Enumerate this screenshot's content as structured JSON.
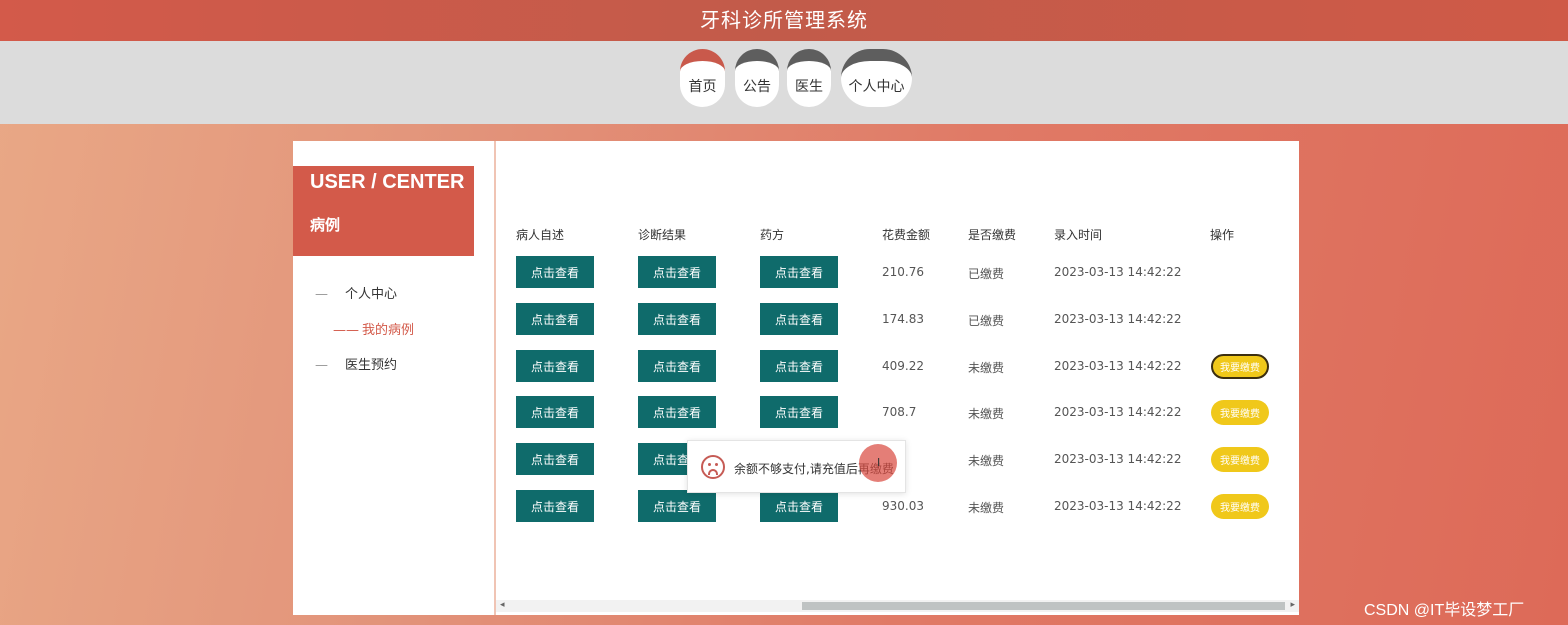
{
  "app_title": "牙科诊所管理系统",
  "nav": [
    "首页",
    "公告",
    "医生",
    "个人中心"
  ],
  "user_center": {
    "title": "USER / CENTER",
    "subtitle": "病例"
  },
  "side_menu": [
    {
      "label": "个人中心",
      "prefix": "—"
    },
    {
      "label": "我的病例",
      "prefix": "——"
    },
    {
      "label": "医生预约",
      "prefix": "—"
    }
  ],
  "table": {
    "headers": [
      "病人自述",
      "诊断结果",
      "药方",
      "花费金额",
      "是否缴费",
      "录入时间",
      "操作"
    ],
    "view_label": "点击查看",
    "pay_label": "我要缴费",
    "rows": [
      {
        "amount": "210.76",
        "paid": "已缴费",
        "time": "2023-03-13 14:42:22",
        "has_pay": false
      },
      {
        "amount": "174.83",
        "paid": "已缴费",
        "time": "2023-03-13 14:42:22",
        "has_pay": false
      },
      {
        "amount": "409.22",
        "paid": "未缴费",
        "time": "2023-03-13 14:42:22",
        "has_pay": true
      },
      {
        "amount": "708.7",
        "paid": "未缴费",
        "time": "2023-03-13 14:42:22",
        "has_pay": true
      },
      {
        "amount": "7",
        "paid": "未缴费",
        "time": "2023-03-13 14:42:22",
        "has_pay": true
      },
      {
        "amount": "930.03",
        "paid": "未缴费",
        "time": "2023-03-13 14:42:22",
        "has_pay": true
      }
    ]
  },
  "toast": {
    "icon": "sad-face-icon",
    "message": "余额不够支付,请充值后再缴费"
  },
  "scroll": {
    "left": "◂",
    "right": "▸"
  },
  "watermark": "CSDN @IT毕设梦工厂",
  "colors": {
    "accent": "#d35a4a",
    "view_button": "#0f6b6b",
    "pay_button": "#f0c81a"
  }
}
